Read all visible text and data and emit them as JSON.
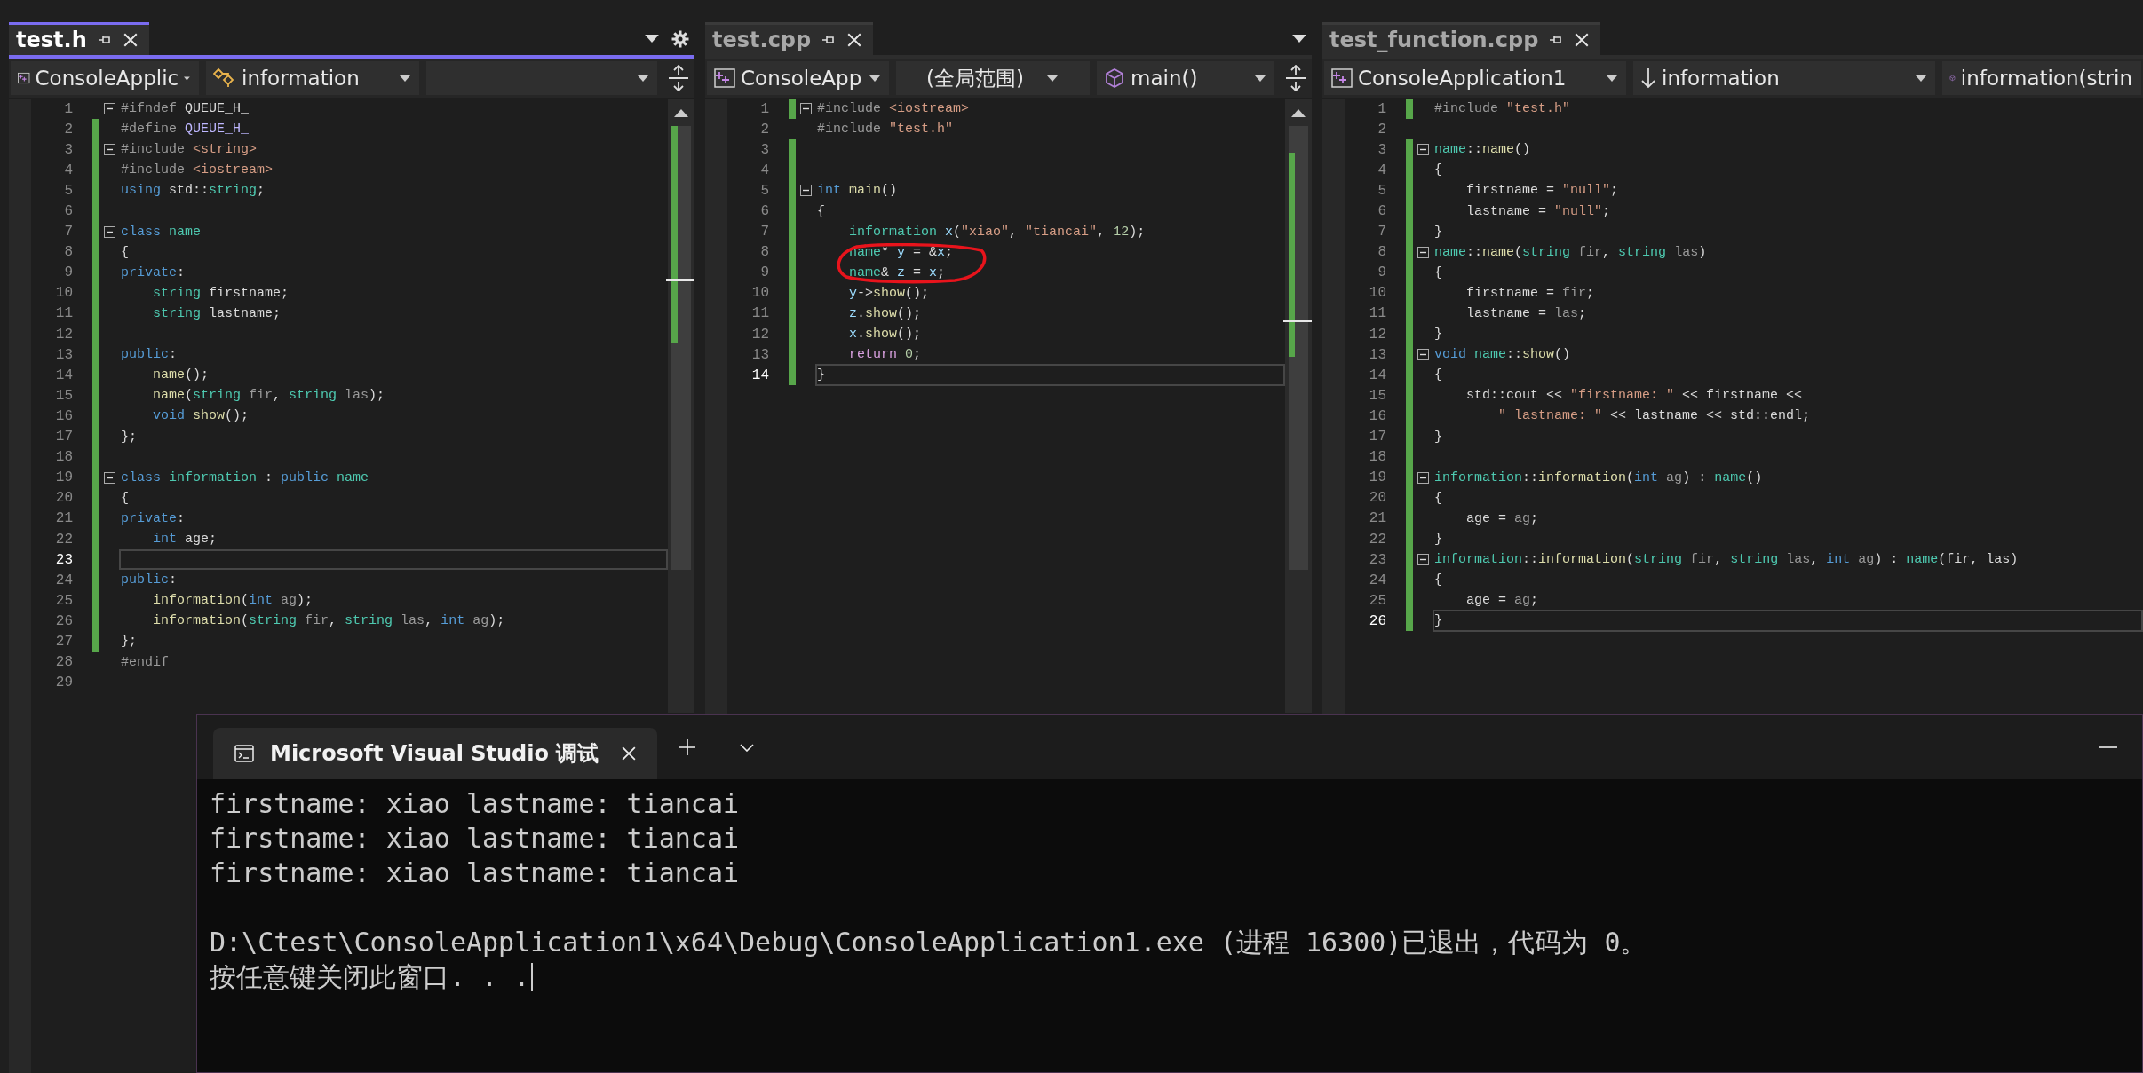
{
  "editors": [
    {
      "tab": {
        "title": "test.h",
        "selected": true
      },
      "tab_icons": [
        {
          "kind": "dropdown"
        },
        {
          "kind": "settings"
        }
      ],
      "scrollbar": true,
      "dropdowns": [
        {
          "label": "ConsoleApplic",
          "kind": "project",
          "caret": true
        },
        {
          "label": "information",
          "kind": "class",
          "caret": true
        },
        {
          "kind": "blank",
          "caret": true
        }
      ],
      "lines": [
        {
          "number": "1",
          "changed": false,
          "foldable": true,
          "current": false,
          "tokens": [
            {
              "text": "#ifndef",
              "kind": "pre"
            },
            {
              "text": " QUEUE_H_",
              "kind": "plain"
            }
          ]
        },
        {
          "number": "2",
          "changed": true,
          "foldable": false,
          "current": false,
          "tokens": [
            {
              "text": "#define",
              "kind": "pre"
            },
            {
              "text": " QUEUE_H_",
              "kind": "macro"
            }
          ]
        },
        {
          "number": "3",
          "changed": true,
          "foldable": true,
          "current": false,
          "tokens": [
            {
              "text": "#include",
              "kind": "pre"
            },
            {
              "text": " <string>",
              "kind": "string"
            }
          ]
        },
        {
          "number": "4",
          "changed": true,
          "foldable": false,
          "current": false,
          "tokens": [
            {
              "text": "#include",
              "kind": "pre"
            },
            {
              "text": " <iostream>",
              "kind": "string"
            }
          ]
        },
        {
          "number": "5",
          "changed": true,
          "foldable": false,
          "current": false,
          "tokens": [
            {
              "text": "using",
              "kind": "keyword"
            },
            {
              "text": " std::",
              "kind": "plain"
            },
            {
              "text": "string",
              "kind": "type"
            },
            {
              "text": ";",
              "kind": "plain"
            }
          ]
        },
        {
          "number": "6",
          "changed": true,
          "foldable": false,
          "current": false
        },
        {
          "number": "7",
          "changed": true,
          "foldable": true,
          "current": false,
          "tokens": [
            {
              "text": "class",
              "kind": "keyword"
            },
            {
              "text": " name",
              "kind": "type"
            }
          ]
        },
        {
          "number": "8",
          "changed": true,
          "foldable": false,
          "current": false,
          "tokens": [
            {
              "text": "{",
              "kind": "plain"
            }
          ]
        },
        {
          "number": "9",
          "changed": true,
          "foldable": false,
          "current": false,
          "tokens": [
            {
              "text": "private",
              "kind": "keyword"
            },
            {
              "text": ":",
              "kind": "plain"
            }
          ]
        },
        {
          "number": "10",
          "changed": true,
          "foldable": false,
          "current": false,
          "tokens": [
            {
              "text": "    string",
              "kind": "type"
            },
            {
              "text": " firstname;",
              "kind": "plain"
            }
          ]
        },
        {
          "number": "11",
          "changed": true,
          "foldable": false,
          "current": false,
          "tokens": [
            {
              "text": "    string",
              "kind": "type"
            },
            {
              "text": " lastname;",
              "kind": "plain"
            }
          ]
        },
        {
          "number": "12",
          "changed": true,
          "foldable": false,
          "current": false
        },
        {
          "number": "13",
          "changed": true,
          "foldable": false,
          "current": false,
          "tokens": [
            {
              "text": "public",
              "kind": "keyword"
            },
            {
              "text": ":",
              "kind": "plain"
            }
          ]
        },
        {
          "number": "14",
          "changed": true,
          "foldable": false,
          "current": false,
          "tokens": [
            {
              "text": "    name",
              "kind": "function"
            },
            {
              "text": "();",
              "kind": "plain"
            }
          ]
        },
        {
          "number": "15",
          "changed": true,
          "foldable": false,
          "current": false,
          "tokens": [
            {
              "text": "    name",
              "kind": "function"
            },
            {
              "text": "(",
              "kind": "plain"
            },
            {
              "text": "string",
              "kind": "type"
            },
            {
              "text": " fir",
              "kind": "param"
            },
            {
              "text": ",",
              "kind": "plain"
            },
            {
              "text": " string",
              "kind": "type"
            },
            {
              "text": " las",
              "kind": "param"
            },
            {
              "text": ");",
              "kind": "plain"
            }
          ]
        },
        {
          "number": "16",
          "changed": true,
          "foldable": false,
          "current": false,
          "tokens": [
            {
              "text": "    void",
              "kind": "keyword"
            },
            {
              "text": " show",
              "kind": "function"
            },
            {
              "text": "();",
              "kind": "plain"
            }
          ]
        },
        {
          "number": "17",
          "changed": true,
          "foldable": false,
          "current": false,
          "tokens": [
            {
              "text": "};",
              "kind": "plain"
            }
          ]
        },
        {
          "number": "18",
          "changed": true,
          "foldable": false,
          "current": false
        },
        {
          "number": "19",
          "changed": true,
          "foldable": true,
          "current": false,
          "tokens": [
            {
              "text": "class",
              "kind": "keyword"
            },
            {
              "text": " information",
              "kind": "type"
            },
            {
              "text": " :",
              "kind": "plain"
            },
            {
              "text": " public",
              "kind": "keyword"
            },
            {
              "text": " name",
              "kind": "type"
            }
          ]
        },
        {
          "number": "20",
          "changed": true,
          "foldable": false,
          "current": false,
          "tokens": [
            {
              "text": "{",
              "kind": "plain"
            }
          ]
        },
        {
          "number": "21",
          "changed": true,
          "foldable": false,
          "current": false,
          "tokens": [
            {
              "text": "private",
              "kind": "keyword"
            },
            {
              "text": ":",
              "kind": "plain"
            }
          ]
        },
        {
          "number": "22",
          "changed": true,
          "foldable": false,
          "current": false,
          "tokens": [
            {
              "text": "    int",
              "kind": "keyword"
            },
            {
              "text": " age;",
              "kind": "plain"
            }
          ]
        },
        {
          "number": "23",
          "changed": true,
          "foldable": false,
          "current": true
        },
        {
          "number": "24",
          "changed": true,
          "foldable": false,
          "current": false,
          "tokens": [
            {
              "text": "public",
              "kind": "keyword"
            },
            {
              "text": ":",
              "kind": "plain"
            }
          ]
        },
        {
          "number": "25",
          "changed": true,
          "foldable": false,
          "current": false,
          "tokens": [
            {
              "text": "    information",
              "kind": "function"
            },
            {
              "text": "(",
              "kind": "plain"
            },
            {
              "text": "int",
              "kind": "keyword"
            },
            {
              "text": " ag",
              "kind": "param"
            },
            {
              "text": ");",
              "kind": "plain"
            }
          ]
        },
        {
          "number": "26",
          "changed": true,
          "foldable": false,
          "current": false,
          "tokens": [
            {
              "text": "    information",
              "kind": "function"
            },
            {
              "text": "(",
              "kind": "plain"
            },
            {
              "text": "string",
              "kind": "type"
            },
            {
              "text": " fir",
              "kind": "param"
            },
            {
              "text": ",",
              "kind": "plain"
            },
            {
              "text": " string",
              "kind": "type"
            },
            {
              "text": " las",
              "kind": "param"
            },
            {
              "text": ",",
              "kind": "plain"
            },
            {
              "text": " int",
              "kind": "keyword"
            },
            {
              "text": " ag",
              "kind": "param"
            },
            {
              "text": ");",
              "kind": "plain"
            }
          ]
        },
        {
          "number": "27",
          "changed": true,
          "foldable": false,
          "current": false,
          "tokens": [
            {
              "text": "};",
              "kind": "plain"
            }
          ]
        },
        {
          "number": "28",
          "changed": false,
          "foldable": false,
          "current": false,
          "tokens": [
            {
              "text": "#endif",
              "kind": "pre"
            }
          ]
        },
        {
          "number": "29",
          "changed": false,
          "foldable": false,
          "current": false
        }
      ]
    },
    {
      "tab": {
        "title": "test.cpp",
        "selected": false
      },
      "tab_icons": [
        {
          "kind": "dropdown"
        }
      ],
      "scrollbar": true,
      "dropdowns": [
        {
          "label": "ConsoleApp",
          "kind": "project",
          "caret": true
        },
        {
          "label": "(全局范围)",
          "kind": "scope",
          "caret": true
        },
        {
          "label": "main()",
          "kind": "method",
          "caret": true
        }
      ],
      "lines": [
        {
          "number": "1",
          "changed": true,
          "foldable": true,
          "current": false,
          "tokens": [
            {
              "text": "#include",
              "kind": "pre"
            },
            {
              "text": " <iostream>",
              "kind": "string"
            }
          ]
        },
        {
          "number": "2",
          "changed": false,
          "foldable": false,
          "current": false,
          "tokens": [
            {
              "text": "#include",
              "kind": "pre"
            },
            {
              "text": " \"test.h\"",
              "kind": "string"
            }
          ]
        },
        {
          "number": "3",
          "changed": true,
          "foldable": false,
          "current": false
        },
        {
          "number": "4",
          "changed": true,
          "foldable": false,
          "current": false
        },
        {
          "number": "5",
          "changed": true,
          "foldable": true,
          "current": false,
          "tokens": [
            {
              "text": "int",
              "kind": "keyword"
            },
            {
              "text": " main",
              "kind": "function"
            },
            {
              "text": "()",
              "kind": "plain"
            }
          ]
        },
        {
          "number": "6",
          "changed": true,
          "foldable": false,
          "current": false,
          "tokens": [
            {
              "text": "{",
              "kind": "plain"
            }
          ]
        },
        {
          "number": "7",
          "changed": true,
          "foldable": false,
          "current": false,
          "tokens": [
            {
              "text": "    information",
              "kind": "type"
            },
            {
              "text": " x",
              "kind": "variable"
            },
            {
              "text": "(",
              "kind": "plain"
            },
            {
              "text": "\"xiao\"",
              "kind": "string"
            },
            {
              "text": ",",
              "kind": "plain"
            },
            {
              "text": " \"tiancai\"",
              "kind": "string"
            },
            {
              "text": ",",
              "kind": "plain"
            },
            {
              "text": " 12",
              "kind": "number"
            },
            {
              "text": ");",
              "kind": "plain"
            }
          ]
        },
        {
          "number": "8",
          "changed": true,
          "foldable": false,
          "current": false,
          "tokens": [
            {
              "text": "    name",
              "kind": "type"
            },
            {
              "text": "*",
              "kind": "plain"
            },
            {
              "text": " y",
              "kind": "variable"
            },
            {
              "text": " = &",
              "kind": "plain"
            },
            {
              "text": "x",
              "kind": "variable"
            },
            {
              "text": ";",
              "kind": "plain"
            }
          ]
        },
        {
          "number": "9",
          "changed": true,
          "foldable": false,
          "current": false,
          "tokens": [
            {
              "text": "    name",
              "kind": "type"
            },
            {
              "text": "&",
              "kind": "plain"
            },
            {
              "text": " z",
              "kind": "variable"
            },
            {
              "text": " =",
              "kind": "plain"
            },
            {
              "text": " x",
              "kind": "variable"
            },
            {
              "text": ";",
              "kind": "plain"
            }
          ]
        },
        {
          "number": "10",
          "changed": true,
          "foldable": false,
          "current": false,
          "tokens": [
            {
              "text": "    y",
              "kind": "variable"
            },
            {
              "text": "->",
              "kind": "plain"
            },
            {
              "text": "show",
              "kind": "function"
            },
            {
              "text": "();",
              "kind": "plain"
            }
          ]
        },
        {
          "number": "11",
          "changed": true,
          "foldable": false,
          "current": false,
          "tokens": [
            {
              "text": "    z",
              "kind": "variable"
            },
            {
              "text": ".",
              "kind": "plain"
            },
            {
              "text": "show",
              "kind": "function"
            },
            {
              "text": "();",
              "kind": "plain"
            }
          ]
        },
        {
          "number": "12",
          "changed": true,
          "foldable": false,
          "current": false,
          "tokens": [
            {
              "text": "    x",
              "kind": "variable"
            },
            {
              "text": ".",
              "kind": "plain"
            },
            {
              "text": "show",
              "kind": "function"
            },
            {
              "text": "();",
              "kind": "plain"
            }
          ]
        },
        {
          "number": "13",
          "changed": true,
          "foldable": false,
          "current": false,
          "tokens": [
            {
              "text": "    return",
              "kind": "control"
            },
            {
              "text": " 0",
              "kind": "number"
            },
            {
              "text": ";",
              "kind": "plain"
            }
          ]
        },
        {
          "number": "14",
          "changed": true,
          "foldable": false,
          "current": true,
          "tokens": [
            {
              "text": "}",
              "kind": "plain"
            }
          ]
        }
      ]
    },
    {
      "tab": {
        "title": "test_function.cpp",
        "selected": false
      },
      "scrollbar": false,
      "dropdowns": [
        {
          "label": "ConsoleApplication1",
          "kind": "project",
          "caret": true
        },
        {
          "label": "information",
          "kind": "arrow",
          "caret": true
        },
        {
          "label": "information(strin",
          "kind": "method",
          "caret": false
        }
      ],
      "lines": [
        {
          "number": "1",
          "changed": true,
          "foldable": false,
          "current": false,
          "tokens": [
            {
              "text": "#include",
              "kind": "pre"
            },
            {
              "text": " \"test.h\"",
              "kind": "string"
            }
          ]
        },
        {
          "number": "2",
          "changed": false,
          "foldable": false,
          "current": false
        },
        {
          "number": "3",
          "changed": true,
          "foldable": true,
          "current": false,
          "tokens": [
            {
              "text": "name",
              "kind": "type"
            },
            {
              "text": "::",
              "kind": "plain"
            },
            {
              "text": "name",
              "kind": "function"
            },
            {
              "text": "()",
              "kind": "plain"
            }
          ]
        },
        {
          "number": "4",
          "changed": true,
          "foldable": false,
          "current": false,
          "tokens": [
            {
              "text": "{",
              "kind": "plain"
            }
          ]
        },
        {
          "number": "5",
          "changed": true,
          "foldable": false,
          "current": false,
          "tokens": [
            {
              "text": "    firstname =",
              "kind": "plain"
            },
            {
              "text": " \"null\"",
              "kind": "string"
            },
            {
              "text": ";",
              "kind": "plain"
            }
          ]
        },
        {
          "number": "6",
          "changed": true,
          "foldable": false,
          "current": false,
          "tokens": [
            {
              "text": "    lastname =",
              "kind": "plain"
            },
            {
              "text": " \"null\"",
              "kind": "string"
            },
            {
              "text": ";",
              "kind": "plain"
            }
          ]
        },
        {
          "number": "7",
          "changed": true,
          "foldable": false,
          "current": false,
          "tokens": [
            {
              "text": "}",
              "kind": "plain"
            }
          ]
        },
        {
          "number": "8",
          "changed": true,
          "foldable": true,
          "current": false,
          "tokens": [
            {
              "text": "name",
              "kind": "type"
            },
            {
              "text": "::",
              "kind": "plain"
            },
            {
              "text": "name",
              "kind": "function"
            },
            {
              "text": "(",
              "kind": "plain"
            },
            {
              "text": "string",
              "kind": "type"
            },
            {
              "text": " fir",
              "kind": "param"
            },
            {
              "text": ",",
              "kind": "plain"
            },
            {
              "text": " string",
              "kind": "type"
            },
            {
              "text": " las",
              "kind": "param"
            },
            {
              "text": ")",
              "kind": "plain"
            }
          ]
        },
        {
          "number": "9",
          "changed": true,
          "foldable": false,
          "current": false,
          "tokens": [
            {
              "text": "{",
              "kind": "plain"
            }
          ]
        },
        {
          "number": "10",
          "changed": true,
          "foldable": false,
          "current": false,
          "tokens": [
            {
              "text": "    firstname =",
              "kind": "plain"
            },
            {
              "text": " fir",
              "kind": "param"
            },
            {
              "text": ";",
              "kind": "plain"
            }
          ]
        },
        {
          "number": "11",
          "changed": true,
          "foldable": false,
          "current": false,
          "tokens": [
            {
              "text": "    lastname =",
              "kind": "plain"
            },
            {
              "text": " las",
              "kind": "param"
            },
            {
              "text": ";",
              "kind": "plain"
            }
          ]
        },
        {
          "number": "12",
          "changed": true,
          "foldable": false,
          "current": false,
          "tokens": [
            {
              "text": "}",
              "kind": "plain"
            }
          ]
        },
        {
          "number": "13",
          "changed": true,
          "foldable": true,
          "current": false,
          "tokens": [
            {
              "text": "void",
              "kind": "keyword"
            },
            {
              "text": " name",
              "kind": "type"
            },
            {
              "text": "::",
              "kind": "plain"
            },
            {
              "text": "show",
              "kind": "function"
            },
            {
              "text": "()",
              "kind": "plain"
            }
          ]
        },
        {
          "number": "14",
          "changed": true,
          "foldable": false,
          "current": false,
          "tokens": [
            {
              "text": "{",
              "kind": "plain"
            }
          ]
        },
        {
          "number": "15",
          "changed": true,
          "foldable": false,
          "current": false,
          "tokens": [
            {
              "text": "    std::cout <<",
              "kind": "plain"
            },
            {
              "text": " \"firstname: \"",
              "kind": "string"
            },
            {
              "text": " << firstname <<",
              "kind": "plain"
            }
          ]
        },
        {
          "number": "16",
          "changed": true,
          "foldable": false,
          "current": false,
          "tokens": [
            {
              "text": "        \" lastname: \"",
              "kind": "string"
            },
            {
              "text": " << lastname << std::endl;",
              "kind": "plain"
            }
          ]
        },
        {
          "number": "17",
          "changed": true,
          "foldable": false,
          "current": false,
          "tokens": [
            {
              "text": "}",
              "kind": "plain"
            }
          ]
        },
        {
          "number": "18",
          "changed": true,
          "foldable": false,
          "current": false
        },
        {
          "number": "19",
          "changed": true,
          "foldable": true,
          "current": false,
          "tokens": [
            {
              "text": "information",
              "kind": "type"
            },
            {
              "text": "::",
              "kind": "plain"
            },
            {
              "text": "information",
              "kind": "function"
            },
            {
              "text": "(",
              "kind": "plain"
            },
            {
              "text": "int",
              "kind": "keyword"
            },
            {
              "text": " ag",
              "kind": "param"
            },
            {
              "text": ") :",
              "kind": "plain"
            },
            {
              "text": " name",
              "kind": "type"
            },
            {
              "text": "()",
              "kind": "plain"
            }
          ]
        },
        {
          "number": "20",
          "changed": true,
          "foldable": false,
          "current": false,
          "tokens": [
            {
              "text": "{",
              "kind": "plain"
            }
          ]
        },
        {
          "number": "21",
          "changed": true,
          "foldable": false,
          "current": false,
          "tokens": [
            {
              "text": "    age =",
              "kind": "plain"
            },
            {
              "text": " ag",
              "kind": "param"
            },
            {
              "text": ";",
              "kind": "plain"
            }
          ]
        },
        {
          "number": "22",
          "changed": true,
          "foldable": false,
          "current": false,
          "tokens": [
            {
              "text": "}",
              "kind": "plain"
            }
          ]
        },
        {
          "number": "23",
          "changed": true,
          "foldable": true,
          "current": false,
          "tokens": [
            {
              "text": "information",
              "kind": "type"
            },
            {
              "text": "::",
              "kind": "plain"
            },
            {
              "text": "information",
              "kind": "function"
            },
            {
              "text": "(",
              "kind": "plain"
            },
            {
              "text": "string",
              "kind": "type"
            },
            {
              "text": " fir",
              "kind": "param"
            },
            {
              "text": ",",
              "kind": "plain"
            },
            {
              "text": " string",
              "kind": "type"
            },
            {
              "text": " las",
              "kind": "param"
            },
            {
              "text": ",",
              "kind": "plain"
            },
            {
              "text": " int",
              "kind": "keyword"
            },
            {
              "text": " ag",
              "kind": "param"
            },
            {
              "text": ") :",
              "kind": "plain"
            },
            {
              "text": " name",
              "kind": "type"
            },
            {
              "text": "(fir, las)",
              "kind": "plain"
            }
          ]
        },
        {
          "number": "24",
          "changed": true,
          "foldable": false,
          "current": false,
          "tokens": [
            {
              "text": "{",
              "kind": "plain"
            }
          ]
        },
        {
          "number": "25",
          "changed": true,
          "foldable": false,
          "current": false,
          "tokens": [
            {
              "text": "    age =",
              "kind": "plain"
            },
            {
              "text": " ag",
              "kind": "param"
            },
            {
              "text": ";",
              "kind": "plain"
            }
          ]
        },
        {
          "number": "26",
          "changed": true,
          "foldable": false,
          "current": true,
          "tokens": [
            {
              "text": "}",
              "kind": "plain"
            }
          ]
        }
      ]
    }
  ],
  "console": {
    "tab_title": "Microsoft Visual Studio 调试",
    "output": [
      "firstname: xiao lastname: tiancai",
      "firstname: xiao lastname: tiancai",
      "firstname: xiao lastname: tiancai"
    ],
    "messages": [
      "D:\\Ctest\\ConsoleApplication1\\x64\\Debug\\ConsoleApplication1.exe (进程 16300)已退出，代码为 0。",
      "按任意键关闭此窗口. . ."
    ],
    "cursor": true
  }
}
